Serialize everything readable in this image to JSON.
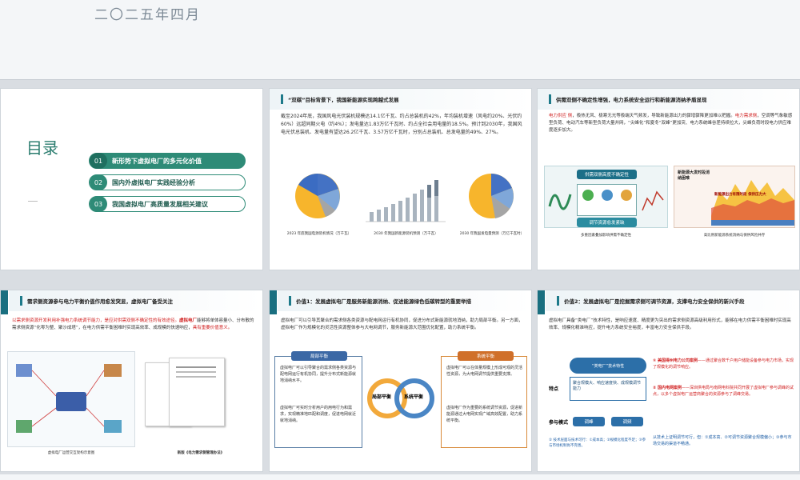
{
  "top_slide": {
    "date": "二〇二五年四月"
  },
  "toc": {
    "title": "目录",
    "items": [
      {
        "num": "01",
        "label": "新形势下虚拟电厂的多元化价值"
      },
      {
        "num": "02",
        "label": "国内外虚拟电厂实践经验分析"
      },
      {
        "num": "03",
        "label": "我国虚拟电厂高质量发展相关建议"
      }
    ]
  },
  "slide2": {
    "title": "“双碳”目标背景下，我国新能源实现跨越式发展",
    "body": "截至2024年底，我国风电光伏装机规模达14.1亿千瓦、约占总装机的42%，年均装机增速（风电约20%、光伏约60%）远超同期火电（约4%）；发电量达1.83万亿千瓦时、约占全社会用电量的18.5%。预计到2030年，我国风电光伏总装机、发电量有望达26.2亿千瓦、3.57万亿千瓦时，分别占总装机、总发电量的49%、27%。",
    "captions": [
      "2023 年底我国电源装机情况（万千瓦）",
      "2030 年我国新能源装机预测（万千瓦）",
      "2030 年我国发电量预测（万亿千瓦时）"
    ]
  },
  "slide3": {
    "title": "供需双侧不确定性增强，电力系统安全运行和新能源消纳矛盾显现",
    "body_pre": "电力供应 侧",
    "body_mid": "，极热无风、极寒无光等极端天气频发，导致新能源出力的骤增骤降更加难以把握。",
    "body_red": "电力需求侧",
    "body_post": "，空调等气象敏感型负荷、电动汽车等新型负荷大量并网，“尖峰化”和夏冬“双峰”更加突、电力系统峰谷差持续拉大，尖峰负荷时段电力供应难度逐步加大。",
    "box1_title": "供需双侧高度不确定性",
    "box1_sub": "调节资源愈发紧缺",
    "box2_title": "新能源大发时段消纳困难",
    "box2_sub": "新能源出力有限时段 保供压力大",
    "cap_left": "多重因素叠加影响供需不确定性",
    "cap_right": "高比例新能源系统消纳与保供风险并存"
  },
  "slide4": {
    "title": "需求侧资源参与电力平衡价值作用愈发突显，虚拟电厂备受关注",
    "body_a": "以需求侧资源开发利用补强电力系统调节能力，是应对供需双侧不确定性的有效途径。",
    "body_b": "虚拟电厂",
    "body_c": "能够将单体容量小、分布散的需求侧资源“化零为整、聚沙成塔”，在电力供需平衡困难时实现高效率、成规模的快速响应，",
    "body_d": "具有重要价值意义。",
    "cap_left": "虚拟电厂运营交互架构示意图",
    "cap_right": "新版《电力需求侧管理办法》"
  },
  "slide5": {
    "title": "价值1：发展虚拟电厂是服务新能源消纳、促进能源绿色低碳转型的重要举措",
    "body": "虚拟电厂可以引导其聚合的需求侧各类资源与配电网运行有机协同，促进分布式新能源就地消纳，助力局部平衡。另一方面，虚拟电厂作为规模化的灵活性资源整体参与大电网调节，服务新能源大范围优化配置，助力系统平衡。",
    "left_title": "局部平衡",
    "right_title": "系统平衡",
    "center_left": "局部平衡",
    "center_right": "系统平衡",
    "left_items": [
      "虚拟电厂可以引导聚合的需求侧各类资源与配电网运行有机协同，提升分布式新能源就地消纳水平。",
      "虚拟电厂可实时分析用户的用电行为和需求，实现精准地匹配和调度，促进电网就近就地消纳。"
    ],
    "right_items": [
      "虚拟电厂可以在体量规模上形成可观的灵活性资源，为大电网调节提供重要支撑。",
      "虚拟电厂作为重要的系统调节资源，促进新能源通过大电网实现广域高效配置，助力系统平衡。"
    ]
  },
  "slide6": {
    "title": "价值2：发展虚拟电厂是挖掘需求侧可调节资源，支撑电力安全保供的新兴手段",
    "body": "虚拟电厂具备“类电厂”技术特性，是响应速度、精度更为突出的需求侧资源高级利用形式，能够在电力供需平衡困难时实现高效率、规模化精准响应，提升电力系统安全裕度，丰富电力安全保供手段。",
    "feature_label": "特点",
    "center_label": "“类电厂”技术特性",
    "left_box": "聚合规模大、响应速度快、成规模调节能力",
    "mode_label": "参与模式",
    "tag1": "调峰",
    "tag2": "调频",
    "red_title1": "① 美国得州电力公司案例",
    "red_text1": "——通过聚合数千户用户储能设备参与电力市场，实现了规模化的调节响应。",
    "red_title2": "② 国内电网案例",
    "red_text2": "——深圳供电局与南网电科院共同开展了虚拟电厂参与调峰的试点，以多个虚拟电厂运营商聚合的资源参与了调峰交易。",
    "bottom_note1": "从技术上证明调节可行，但：①成本高、②可调节资源聚合规模偏小；③参与市场交易的渠道不畅通。",
    "bottom_note2": "②  技术层面与技术可行：①成本高；②规模化程度不足；③参与市场机制尚不完善。"
  }
}
